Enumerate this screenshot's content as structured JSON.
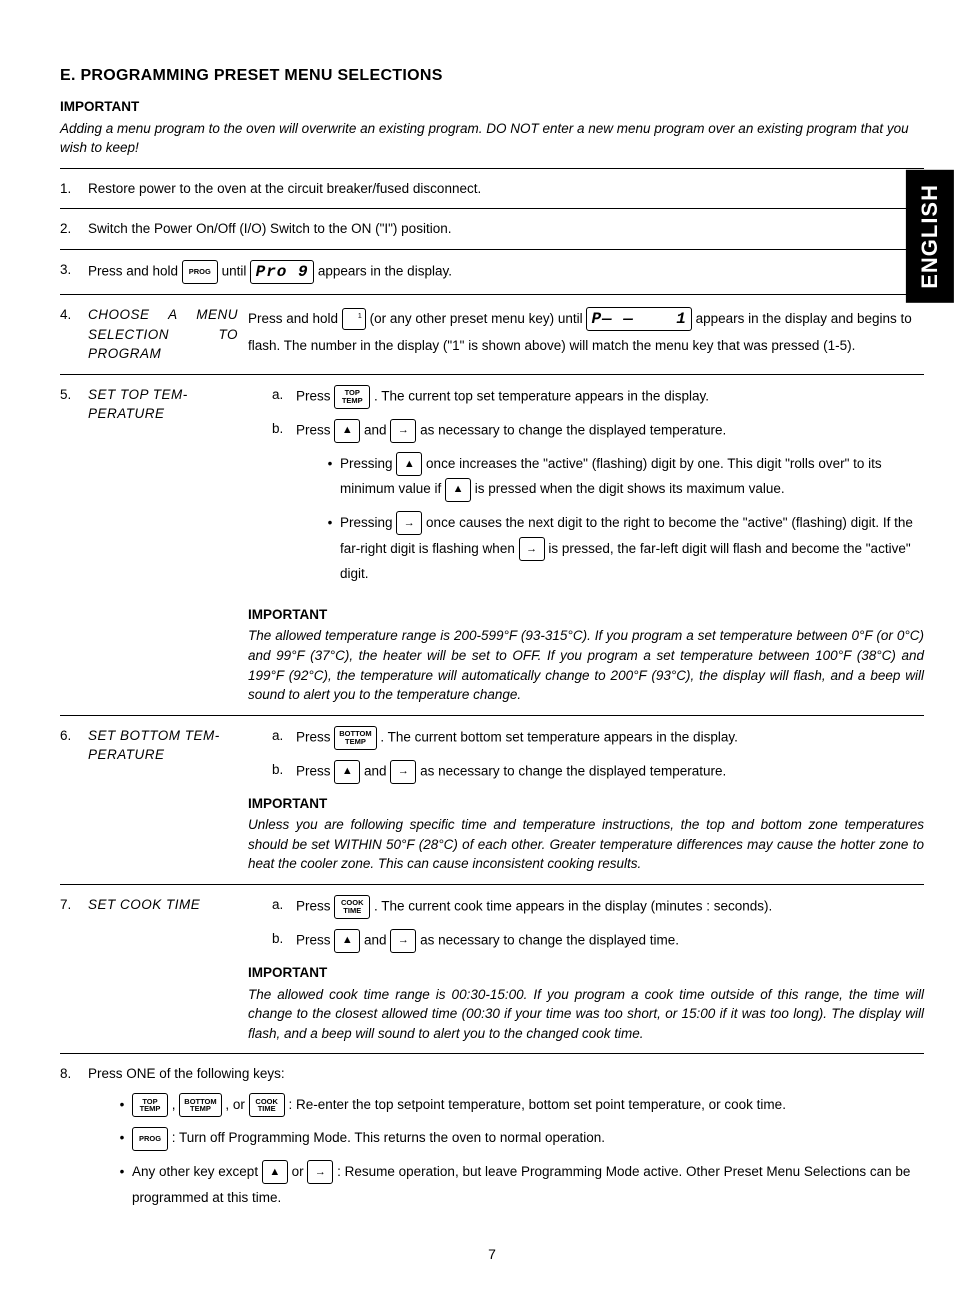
{
  "sideTab": "ENGLISH",
  "pageNumber": "7",
  "heading": "E.  PROGRAMMING PRESET MENU SELECTIONS",
  "introImportantLabel": "IMPORTANT",
  "introImportantText": "Adding a menu program to the oven will overwrite an existing program.  DO NOT enter a new menu program over an existing program that you wish to keep!",
  "keys": {
    "prog": "PROG",
    "topTemp": "TOP\nTEMP",
    "bottomTemp": "BOTTOM\nTEMP",
    "cookTime": "COOK\nTIME",
    "up": "▲",
    "right": "→",
    "presetSup": "1"
  },
  "displays": {
    "prog": "Pro 9",
    "pdash": "P— —    1"
  },
  "steps": {
    "s1": {
      "num": "1.",
      "text": "Restore power to the oven at the circuit breaker/fused disconnect."
    },
    "s2": {
      "num": "2.",
      "text": "Switch the Power On/Off (I/O) Switch to the ON (\"I\") position."
    },
    "s3": {
      "num": "3.",
      "t1": "Press and hold ",
      "t2": " until ",
      "t3": " appears in the display."
    },
    "s4": {
      "num": "4.",
      "label": "CHOOSE A MENU SELECTION TO PROGRAM",
      "t1": "Press and hold ",
      "t2": " (or any other preset menu key) until ",
      "t3": " appears in the display and begins to flash.  The number in the display (\"1\" is shown above) will match the menu key that was pressed (1-5)."
    },
    "s5": {
      "num": "5.",
      "label": "SET TOP TEM-PERATURE",
      "a_t1": "Press ",
      "a_t2": ".  The current top set temperature appears in the display.",
      "b_t1": "Press ",
      "b_and": " and ",
      "b_t2": " as necessary to change the displayed temperature.",
      "bul1_t1": "Pressing ",
      "bul1_t2": " once increases the \"active\" (flashing) digit by one.  This digit \"rolls over\" to its minimum value if ",
      "bul1_t3": " is pressed when the digit shows its maximum value.",
      "bul2_t1": "Pressing ",
      "bul2_t2": " once causes the next digit to the right to become the \"active\" (flashing) digit.  If the far-right digit is flashing when ",
      "bul2_t3": " is pressed, the far-left digit will flash and become the \"active\" digit.",
      "impLabel": "IMPORTANT",
      "impText": "The allowed temperature range is 200-599°F (93-315°C).  If you program a set temperature between 0°F (or 0°C) and 99°F (37°C), the heater will be set to OFF.  If you program a set temperature between 100°F (38°C) and 199°F (92°C), the temperature will automatically change to 200°F (93°C), the display will flash, and a beep will sound to alert you to the temperature change."
    },
    "s6": {
      "num": "6.",
      "label": "SET BOTTOM TEM-PERATURE",
      "a_t1": "Press ",
      "a_t2": ".  The current bottom set temperature appears in the display.",
      "b_t1": "Press ",
      "b_and": " and ",
      "b_t2": " as necessary to change the displayed temperature.",
      "impLabel": "IMPORTANT",
      "impText": "Unless you are following specific time and temperature instructions, the top and bottom zone temperatures should be set WITHIN 50°F (28°C) of each other.  Greater temperature differences may cause the hotter zone to heat the cooler zone.  This can cause inconsistent cooking results."
    },
    "s7": {
      "num": "7.",
      "label": "SET COOK TIME",
      "a_t1": "Press ",
      "a_t2": ".  The current cook time appears in the display (minutes : seconds).",
      "b_t1": "Press ",
      "b_and": " and ",
      "b_t2": " as necessary to change the displayed time.",
      "impLabel": "IMPORTANT",
      "impText": "The allowed cook time range is 00:30-15:00.  If you program a cook time outside of this range, the time will change to the closest allowed time (00:30 if your time was too short, or 15:00 if it was too long).  The display will flash, and a beep will sound to alert you to the changed cook time."
    },
    "s8": {
      "num": "8.",
      "lead": "Press ONE of the following keys:",
      "opt1_sep1": " , ",
      "opt1_sep2": " , or ",
      "opt1_txt": " :   Re-enter the top setpoint temperature, bottom set point temperature, or cook time.",
      "opt2_txt": " :   Turn off Programming Mode.  This returns the oven to normal operation.",
      "opt3_t1": "Any other key except ",
      "opt3_or": " or ",
      "opt3_t2": " :   Resume operation, but leave Programming Mode active.  Other Preset Menu Selections can be programmed at this time."
    }
  }
}
